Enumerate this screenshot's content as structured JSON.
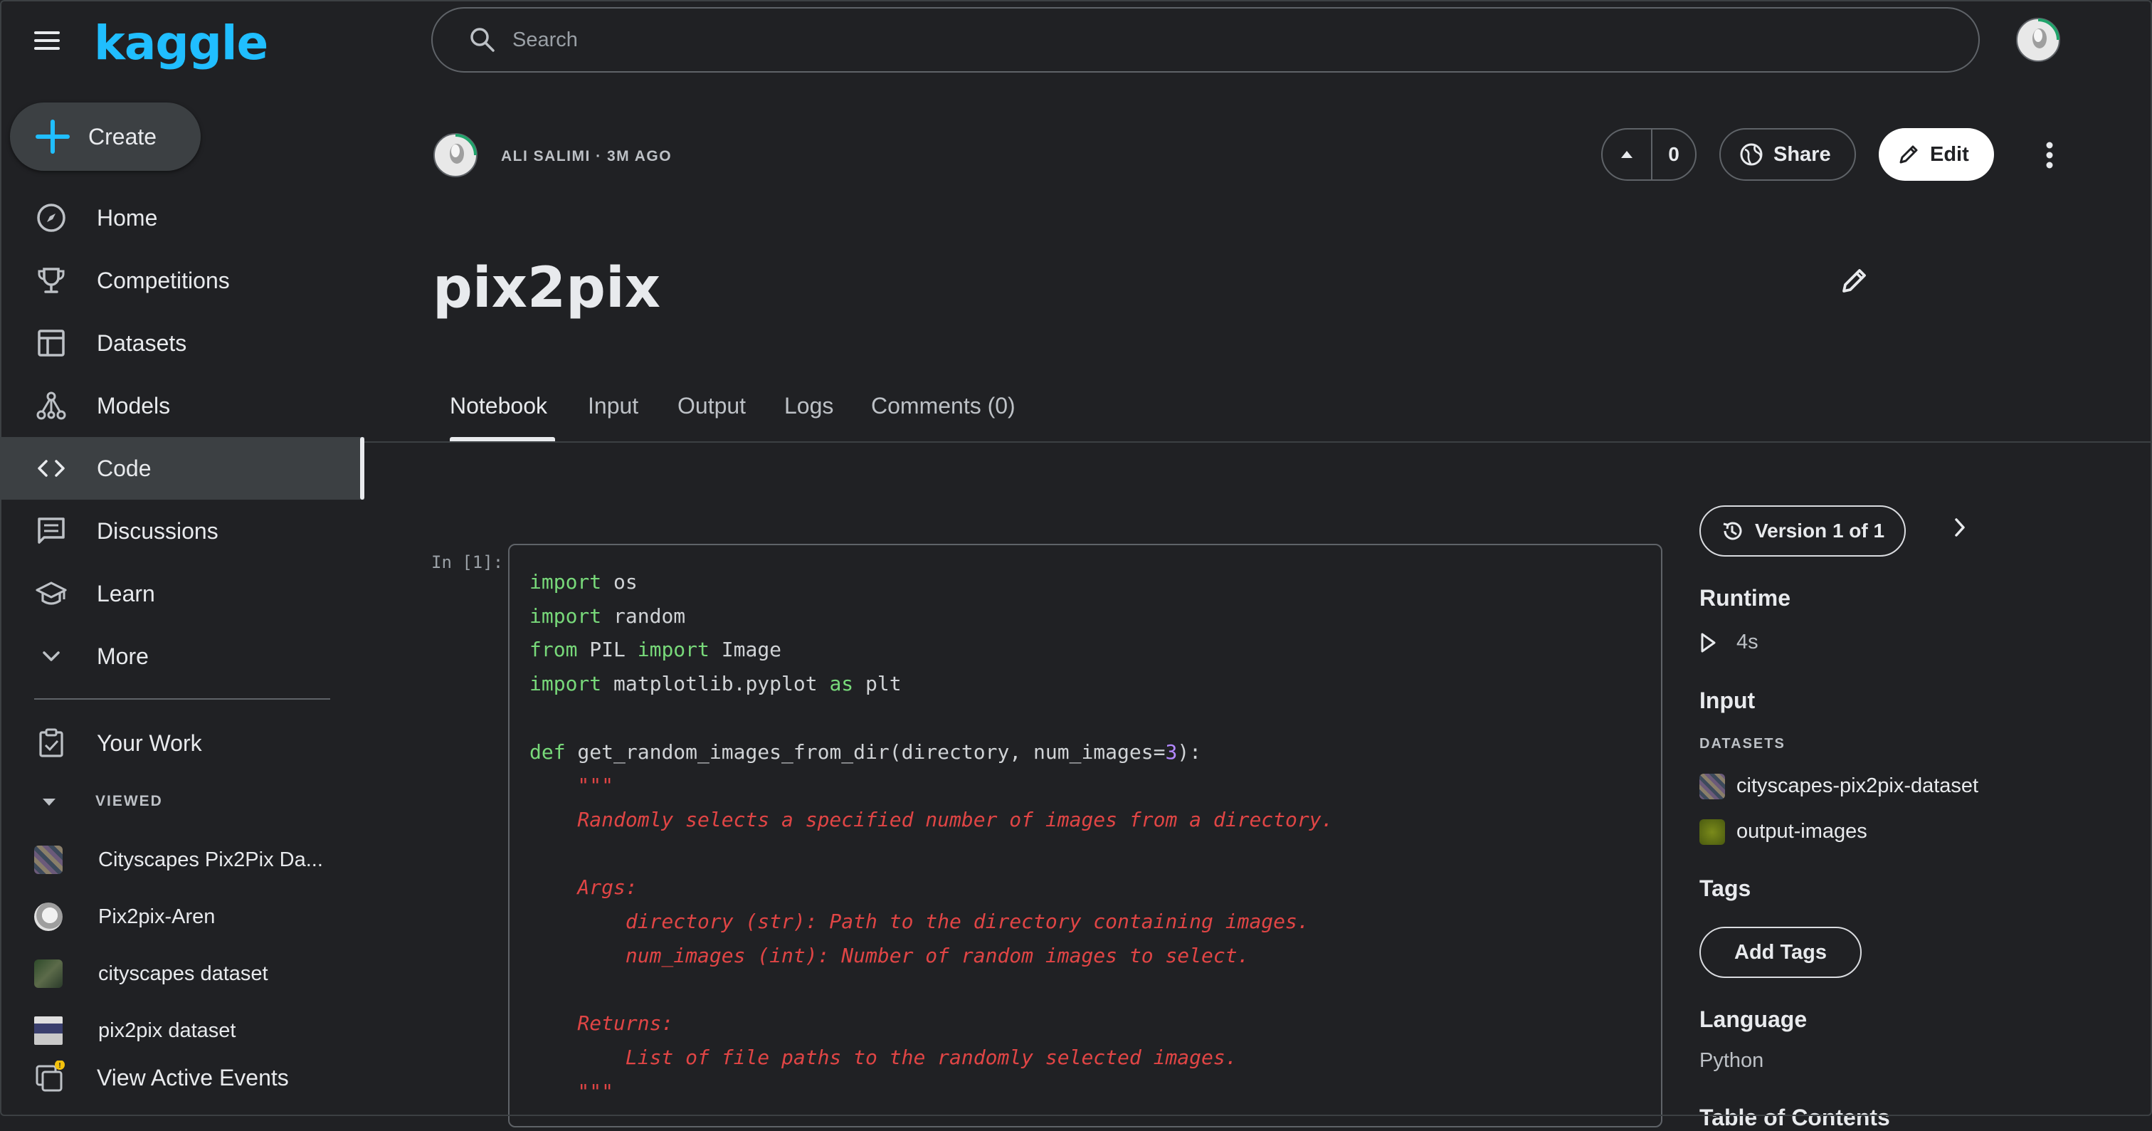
{
  "sidebar": {
    "logo": "kaggle",
    "create_label": "Create",
    "nav": [
      {
        "label": "Home",
        "icon": "compass-icon"
      },
      {
        "label": "Competitions",
        "icon": "trophy-icon"
      },
      {
        "label": "Datasets",
        "icon": "table-icon"
      },
      {
        "label": "Models",
        "icon": "models-icon"
      },
      {
        "label": "Code",
        "icon": "code-icon",
        "active": true
      },
      {
        "label": "Discussions",
        "icon": "discussion-icon"
      },
      {
        "label": "Learn",
        "icon": "school-icon"
      },
      {
        "label": "More",
        "icon": "chevron-down-icon"
      }
    ],
    "your_work": "Your Work",
    "viewed_label": "VIEWED",
    "viewed": [
      {
        "label": "Cityscapes Pix2Pix Da..."
      },
      {
        "label": "Pix2pix-Aren"
      },
      {
        "label": "cityscapes dataset"
      },
      {
        "label": "pix2pix dataset"
      }
    ],
    "active_events": "View Active Events",
    "events_badge": "!"
  },
  "search": {
    "placeholder": "Search"
  },
  "header": {
    "author_meta": "ALI SALIMI · 3M AGO",
    "vote_count": "0",
    "share_label": "Share",
    "edit_label": "Edit",
    "title": "pix2pix"
  },
  "tabs": [
    "Notebook",
    "Input",
    "Output",
    "Logs",
    "Comments (0)"
  ],
  "cell": {
    "prompt": "In [1]:"
  },
  "panel": {
    "version_label": "Version 1 of 1",
    "runtime_heading": "Runtime",
    "runtime_value": "4s",
    "input_heading": "Input",
    "datasets_label": "DATASETS",
    "datasets": [
      "cityscapes-pix2pix-dataset",
      "output-images"
    ],
    "tags_heading": "Tags",
    "add_tags_label": "Add Tags",
    "language_heading": "Language",
    "language_value": "Python",
    "toc_heading": "Table of Contents"
  },
  "colors": {
    "background": "#202124",
    "kaggle_blue": "#20beff",
    "keyword_green": "#78d97a",
    "docstring_red": "#e04545",
    "number_purple": "#b388ff"
  }
}
